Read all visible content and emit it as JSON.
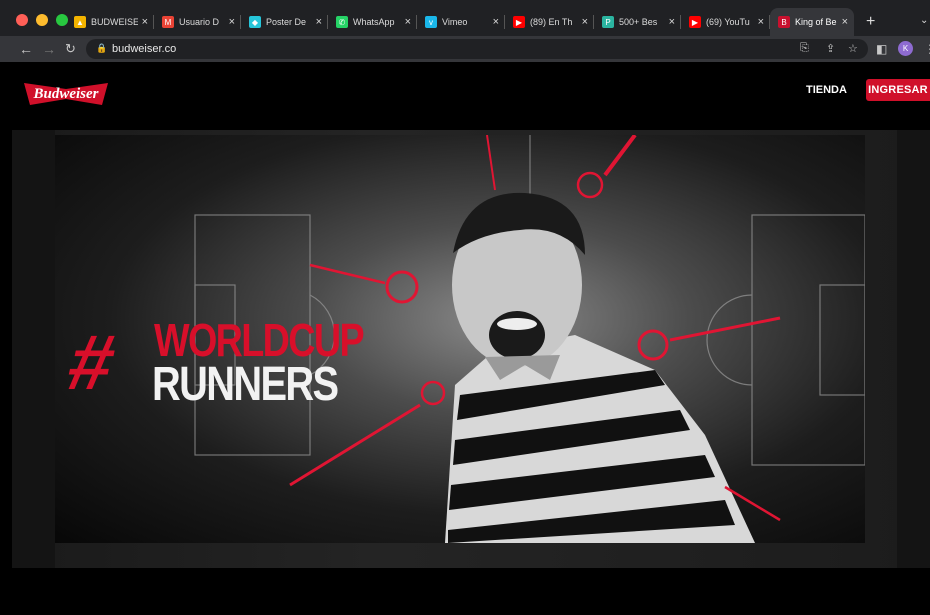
{
  "browser": {
    "tabs": [
      {
        "title": "BUDWEISER",
        "icon": "drive-icon",
        "color": "#f4b400",
        "active": false
      },
      {
        "title": "Usuario D",
        "icon": "gmail-icon",
        "color": "#ea4335",
        "active": false
      },
      {
        "title": "Poster De",
        "icon": "poster-icon",
        "color": "#26c6da",
        "active": false
      },
      {
        "title": "WhatsApp",
        "icon": "whatsapp-icon",
        "color": "#25d366",
        "active": false
      },
      {
        "title": "Vimeo",
        "icon": "vimeo-icon",
        "color": "#1ab7ea",
        "active": false
      },
      {
        "title": "(89) En Th",
        "icon": "youtube-icon",
        "color": "#ff0000",
        "active": false
      },
      {
        "title": "500+ Bes",
        "icon": "bookmark-icon",
        "color": "#2bb5a1",
        "active": false
      },
      {
        "title": "(69) YouTu",
        "icon": "youtube-icon",
        "color": "#ff0000",
        "active": false
      },
      {
        "title": "King of Be",
        "icon": "budweiser-icon",
        "color": "#c8102e",
        "active": true
      }
    ],
    "url": "budweiser.co",
    "profile_initial": "K"
  },
  "site": {
    "logo": "Budweiser",
    "nav_store": "TIENDA",
    "login_button": "INGRESAR"
  },
  "hero": {
    "hashtag": "#",
    "line1": "WORLDCUP",
    "line2": "RUNNERS"
  },
  "colors": {
    "brand_red": "#d0102a",
    "chrome_dark": "#202124",
    "chrome_toolbar": "#35363a"
  }
}
